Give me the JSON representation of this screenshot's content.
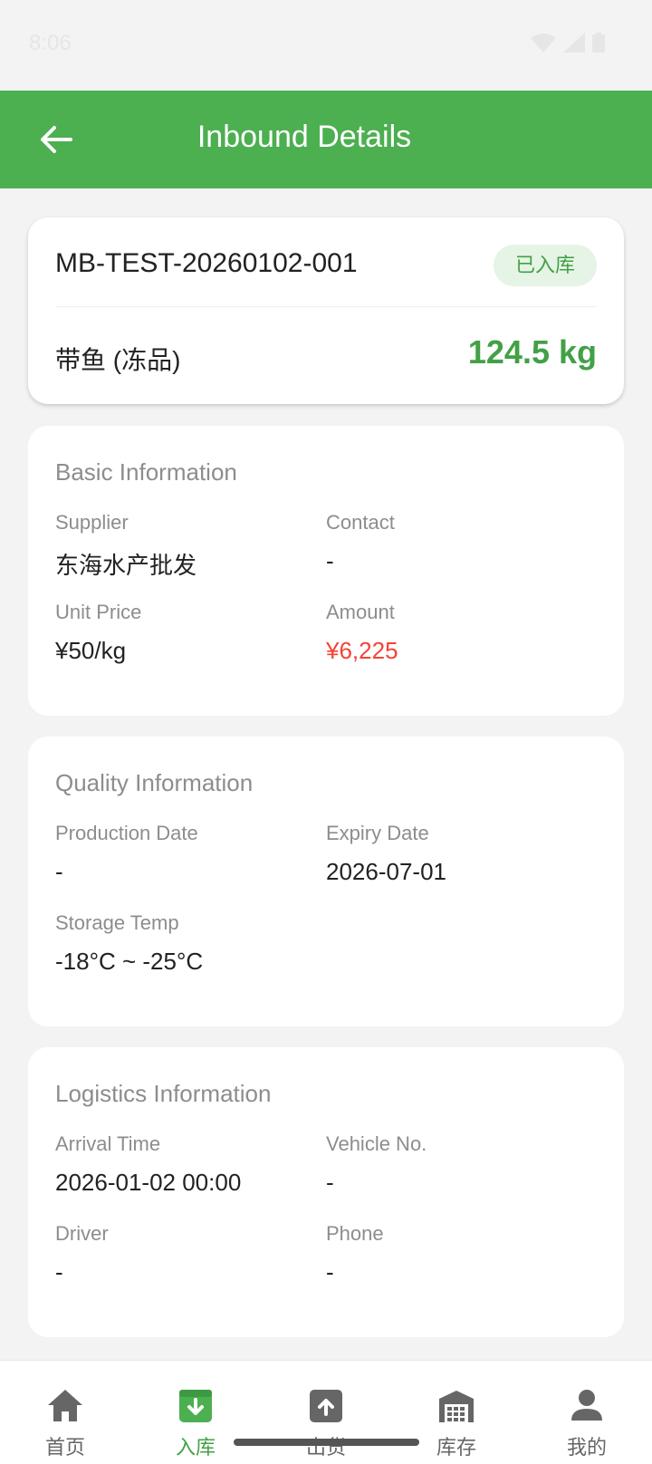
{
  "status_bar": {
    "time": "8:06"
  },
  "app_bar": {
    "title": "Inbound Details"
  },
  "summary": {
    "order_no": "MB-TEST-20260102-001",
    "status": "已入库",
    "product": "带鱼 (冻品)",
    "weight": "124.5 kg"
  },
  "basic": {
    "title": "Basic Information",
    "fields": [
      {
        "label": "Supplier",
        "value": "东海水产批发"
      },
      {
        "label": "Contact",
        "value": "-"
      },
      {
        "label": "Unit Price",
        "value": "¥50/kg"
      },
      {
        "label": "Amount",
        "value": "¥6,225"
      }
    ]
  },
  "quality": {
    "title": "Quality Information",
    "fields": [
      {
        "label": "Production Date",
        "value": "-"
      },
      {
        "label": "Expiry Date",
        "value": "2026-07-01"
      },
      {
        "label": "Storage Temp",
        "value": "-18°C ~ -25°C"
      }
    ]
  },
  "logistics": {
    "title": "Logistics Information",
    "fields": [
      {
        "label": "Arrival Time",
        "value": "2026-01-02 00:00"
      },
      {
        "label": "Vehicle No.",
        "value": "-"
      },
      {
        "label": "Driver",
        "value": "-"
      },
      {
        "label": "Phone",
        "value": "-"
      }
    ]
  },
  "bottom_nav": {
    "items": [
      {
        "label": "首页",
        "icon": "home-icon"
      },
      {
        "label": "入库",
        "icon": "inbound-icon",
        "active": true
      },
      {
        "label": "出货",
        "icon": "outbound-icon"
      },
      {
        "label": "库存",
        "icon": "warehouse-icon"
      },
      {
        "label": "我的",
        "icon": "person-icon"
      }
    ]
  },
  "colors": {
    "primary": "#4caf50",
    "accent_text": "#43a047",
    "amount_red": "#f44336",
    "badge_bg": "#e5f4e5"
  }
}
